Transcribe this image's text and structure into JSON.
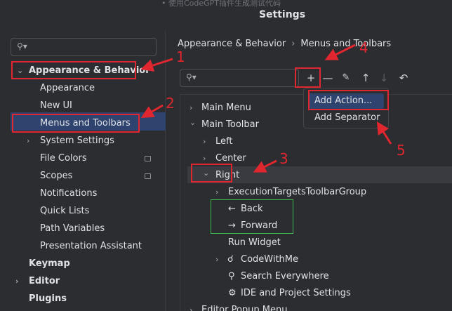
{
  "window": {
    "title": "Settings",
    "behind_text": "• 使用CodeGPT插件生成测试代码"
  },
  "sidebar": {
    "search_placeholder": "",
    "items": [
      {
        "label": "Appearance & Behavior"
      },
      {
        "label": "Appearance"
      },
      {
        "label": "New UI"
      },
      {
        "label": "Menus and Toolbars"
      },
      {
        "label": "System Settings"
      },
      {
        "label": "File Colors"
      },
      {
        "label": "Scopes"
      },
      {
        "label": "Notifications"
      },
      {
        "label": "Quick Lists"
      },
      {
        "label": "Path Variables"
      },
      {
        "label": "Presentation Assistant"
      },
      {
        "label": "Keymap"
      },
      {
        "label": "Editor"
      },
      {
        "label": "Plugins"
      }
    ]
  },
  "main": {
    "breadcrumb": {
      "parent": "Appearance & Behavior",
      "current": "Menus and Toolbars"
    },
    "toolbar": {
      "add": "+",
      "remove": "—",
      "edit": "✎",
      "move_up": "↑",
      "move_down": "↓",
      "restore": "↶"
    },
    "tree": [
      {
        "label": "Main Menu"
      },
      {
        "label": "Main Toolbar"
      },
      {
        "label": "Left"
      },
      {
        "label": "Center"
      },
      {
        "label": "Right"
      },
      {
        "label": "ExecutionTargetsToolbarGroup"
      },
      {
        "label": "Back"
      },
      {
        "label": "Forward"
      },
      {
        "label": "Run Widget"
      },
      {
        "label": "CodeWithMe"
      },
      {
        "label": "Search Everywhere"
      },
      {
        "label": "IDE and Project Settings"
      },
      {
        "label": "Editor Popup Menu"
      }
    ],
    "popup": {
      "add_action": "Add Action...",
      "add_separator": "Add Separator"
    }
  },
  "annotations": {
    "n1": "1",
    "n2": "2",
    "n3": "3",
    "n4": "4",
    "n5": "5"
  },
  "colors": {
    "background": "#2b2d30",
    "selection": "#2e436e",
    "annotation_red": "#e0262f",
    "annotation_green": "#3fb950"
  }
}
